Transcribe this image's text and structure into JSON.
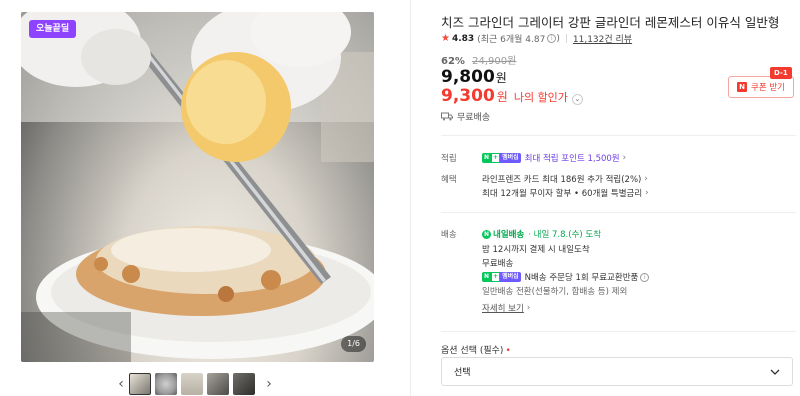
{
  "gallery": {
    "badge": "오늘끝딜",
    "page_indicator": "1/6",
    "thumbnail_count": 5
  },
  "product": {
    "title": "치즈 그라인더 그레이터 강판 글라인더 레몬제스터 이유식 일반형",
    "rating": "4.83",
    "rating_sub": "(최근 6개월 4.87",
    "rating_sub_close": ")",
    "review_count": "11,132건 리뷰",
    "discount_rate": "62%",
    "original_price": "24,900원",
    "price": "9,800",
    "price_unit": "원",
    "my_sale_price": "9,300",
    "my_sale_unit": "원",
    "my_sale_label": "나의 할인가",
    "coupon_label": "쿠폰 받기",
    "coupon_tag": "D-1",
    "shipping_short": "무료배송"
  },
  "details": {
    "points_label": "적립",
    "points_text": "최대 적립 포인트 1,500원",
    "benefit_label": "혜택",
    "benefit_line1": "라인프렌즈 카드 최대 186원 추가 적립(2%)",
    "benefit_line2": "최대 12개월 무이자 할부 • 60개월 특별금리",
    "delivery_label": "배송",
    "tomorrow_badge": "내일배송",
    "delivery_date": "· 내일 7.8.(수) 도착",
    "delivery_cutoff": "밤 12시까지 결제 시 내일도착",
    "delivery_free": "무료배송",
    "exchange_text": "N배송 주문당 1회 무료교환반품",
    "exchange_note": "일반배송 전환(선물하기, 합배송 등) 제외",
    "see_more": "자세히 보기"
  },
  "option": {
    "label": "옵션 선택 (필수)",
    "required_mark": "•",
    "select_value": "선택"
  },
  "colors": {
    "accent_red": "#f23a2e",
    "badge_purple": "#8e44ff",
    "npay_green": "#03c75a"
  }
}
